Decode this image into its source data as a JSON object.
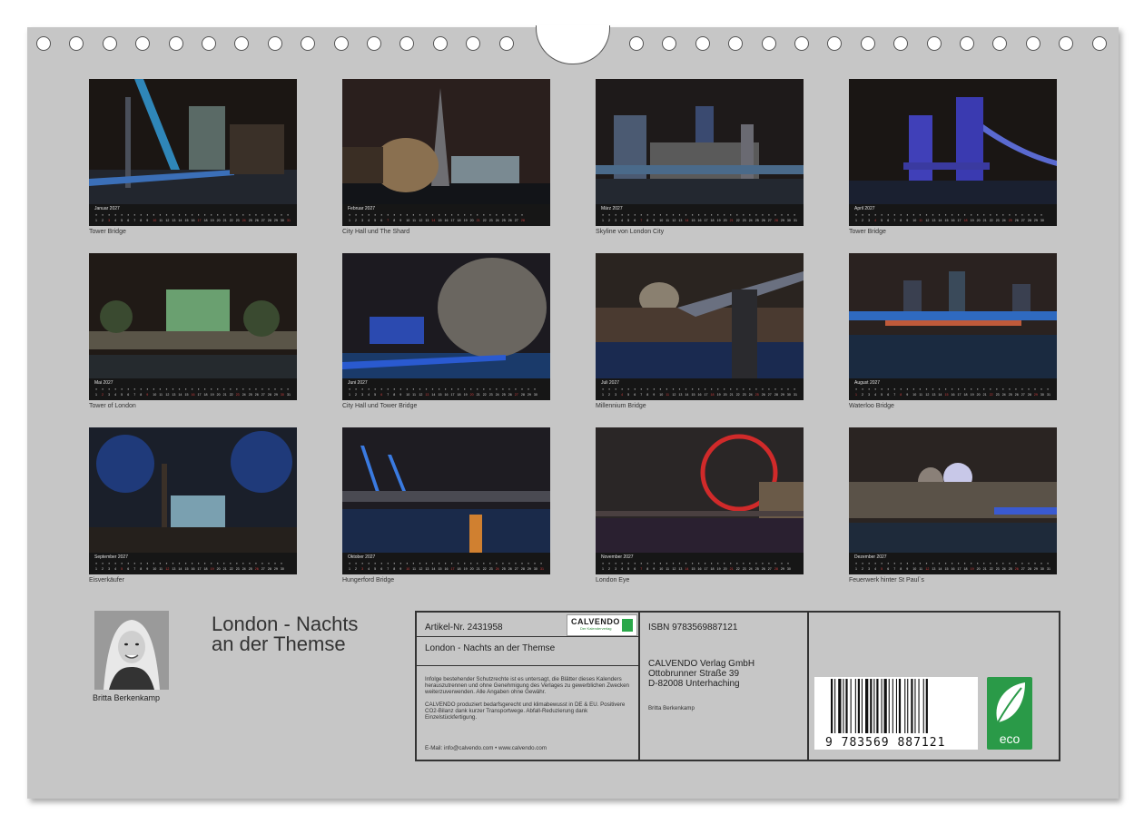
{
  "calendar": {
    "title_line1": "London - Nachts",
    "title_line2": "an der Themse",
    "author": "Britta Berkenkamp",
    "months": [
      {
        "name": "Januar 2027",
        "caption": "Tower Bridge",
        "offset": 4,
        "days": 31
      },
      {
        "name": "Februar 2027",
        "caption": "City Hall und The Shard",
        "offset": 0,
        "days": 28
      },
      {
        "name": "März 2027",
        "caption": "Skyline von London City",
        "offset": 0,
        "days": 31
      },
      {
        "name": "April 2027",
        "caption": "Tower Bridge",
        "offset": 3,
        "days": 30
      },
      {
        "name": "Mai 2027",
        "caption": "Tower of London",
        "offset": 5,
        "days": 31
      },
      {
        "name": "Juni 2027",
        "caption": "City Hall und Tower Bridge",
        "offset": 1,
        "days": 30
      },
      {
        "name": "Juli 2027",
        "caption": "Millennium Bridge",
        "offset": 3,
        "days": 31
      },
      {
        "name": "August 2027",
        "caption": "Waterloo Bridge",
        "offset": 6,
        "days": 31
      },
      {
        "name": "September 2027",
        "caption": "Eisverkäufer",
        "offset": 2,
        "days": 30
      },
      {
        "name": "Oktober 2027",
        "caption": "Hungerford Bridge",
        "offset": 4,
        "days": 31
      },
      {
        "name": "November 2027",
        "caption": "London Eye",
        "offset": 0,
        "days": 30
      },
      {
        "name": "Dezember 2027",
        "caption": "Feuerwerk hinter St Paul`s",
        "offset": 2,
        "days": 31
      }
    ]
  },
  "info": {
    "article": "Artikel-Nr. 2431958",
    "logo_text": "CALVENDO",
    "logo_sub": "Der Kalenderverlag",
    "product_title": "London - Nachts an der Themse",
    "legal_1": "Infolge bestehender Schutzrechte ist es untersagt, die Blätter dieses Kalenders herauszutrennen und ohne Genehmigung des Verlages zu gewerblichen Zwecken weiterzuverwenden. Alle Angaben ohne Gewähr.",
    "legal_2": "CALVENDO produziert bedarfsgerecht und klimabewusst in DE & EU. Positivere CO2-Bilanz dank kurzer Transportwege. Abfall-Reduzierung dank Einzelstückfertigung.",
    "email": "E-Mail: info@calvendo.com • www.calvendo.com",
    "isbn": "ISBN 9783569887121",
    "publisher_1": "CALVENDO Verlag GmbH",
    "publisher_2": "Ottobrunner Straße 39",
    "publisher_3": "D-82008 Unterhaching",
    "credit": "Britta Berkenkamp",
    "barcode_number": "9 783569 887121",
    "eco_label": "eco"
  },
  "colors": {
    "page": "#c6c6c6",
    "calbar": "#161616",
    "eco": "#2a9a48"
  },
  "icons": [
    "binding-ring-icon",
    "hanger-notch-icon",
    "eco-leaf-icon",
    "barcode-icon"
  ]
}
